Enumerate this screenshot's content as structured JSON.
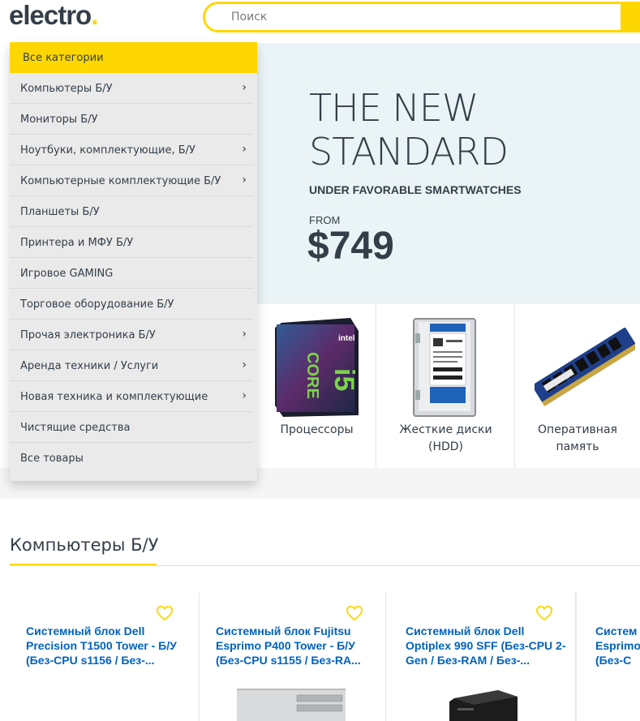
{
  "header": {
    "logo_text": "electro",
    "logo_dot": ".",
    "search_placeholder": "Поиск"
  },
  "categories": {
    "heading": "Все категории",
    "items": [
      {
        "label": "Компьютеры Б/У",
        "has_children": true
      },
      {
        "label": "Мониторы Б/У",
        "has_children": false
      },
      {
        "label": "Ноутбуки, комплектующие, Б/У",
        "has_children": true
      },
      {
        "label": "Компьютерные комплектующие Б/У",
        "has_children": true
      },
      {
        "label": "Планшеты Б/У",
        "has_children": false
      },
      {
        "label": "Принтера и МФУ Б/У",
        "has_children": false
      },
      {
        "label": "Игровое GAMING",
        "has_children": false
      },
      {
        "label": "Торговое оборудование Б/У",
        "has_children": false
      },
      {
        "label": "Прочая электроника Б/У",
        "has_children": true
      },
      {
        "label": "Аренда техники / Услуги",
        "has_children": true
      },
      {
        "label": "Новая техника и комплектующие",
        "has_children": true
      },
      {
        "label": "Чистящие средства",
        "has_children": false
      },
      {
        "label": "Все товары",
        "has_children": false
      }
    ]
  },
  "hero": {
    "title_line1": "THE NEW",
    "title_line2": "STANDARD",
    "subtitle": "UNDER FAVORABLE SMARTWATCHES",
    "from_label": "FROM",
    "price": "$749"
  },
  "tiles": [
    {
      "label": "Процессоры",
      "icon": "cpu-box-icon"
    },
    {
      "label": "Жесткие диски (HDD)",
      "icon": "hdd-icon"
    },
    {
      "label": "Оперативная память",
      "icon": "ram-icon"
    }
  ],
  "section": {
    "title": "Компьютеры Б/У"
  },
  "products": [
    {
      "name": "Системный блок Dell Precision T1500 Tower - Б/У (Без-CPU s1156 / Без-..."
    },
    {
      "name": "Системный блок Fujitsu Esprimo P400 Tower - Б/У (Без-CPU s1155 / Без-RA..."
    },
    {
      "name": "Системный блок Dell Optiplex 990 SFF (Без-CPU 2-Gen / Без-RAM / Без-..."
    },
    {
      "name": "Систем Esprimo (Без-C"
    }
  ],
  "colors": {
    "accent": "#fed700",
    "text": "#333e48",
    "link": "#0062bd",
    "hero_bg": "#eaf3f6"
  }
}
